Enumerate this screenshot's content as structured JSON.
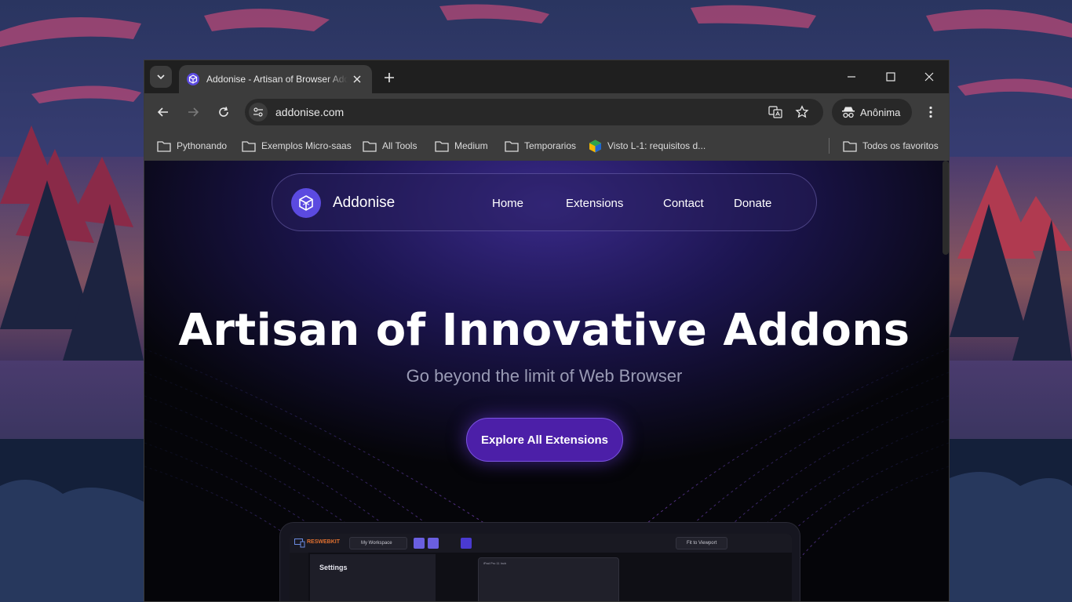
{
  "browser": {
    "tab": {
      "title": "Addonise - Artisan of Browser Addons"
    },
    "omnibox": {
      "url": "addonise.com"
    },
    "profile": {
      "label": "Anônima"
    },
    "bookmarks": [
      {
        "label": "Pythonando",
        "type": "folder"
      },
      {
        "label": "Exemplos Micro-saas",
        "type": "folder"
      },
      {
        "label": "All Tools",
        "type": "folder"
      },
      {
        "label": "Medium",
        "type": "folder"
      },
      {
        "label": "Temporarios",
        "type": "folder"
      },
      {
        "label": "Visto L-1: requisitos d...",
        "type": "site"
      }
    ],
    "all_bookmarks": {
      "label": "Todos os favoritos"
    }
  },
  "page": {
    "brand": {
      "name": "Addonise"
    },
    "nav": [
      "Home",
      "Extensions",
      "Contact",
      "Donate"
    ],
    "hero": {
      "title": "Artisan of Innovative Addons",
      "subtitle": "Go beyond the limit of Web Browser",
      "cta": "Explore All Extensions"
    },
    "preview": {
      "brand": "RESWEBKIT",
      "workspace": "My Workspace",
      "fit": "Fit to Viewport",
      "panel_title": "Settings",
      "device_label": "iPad Pro 11 Inch"
    }
  },
  "colors": {
    "accent": "#5b4ae0",
    "cta": "#4c1fa8",
    "browser_frame": "#1f1f1f",
    "toolbar": "#3c3c3c"
  }
}
